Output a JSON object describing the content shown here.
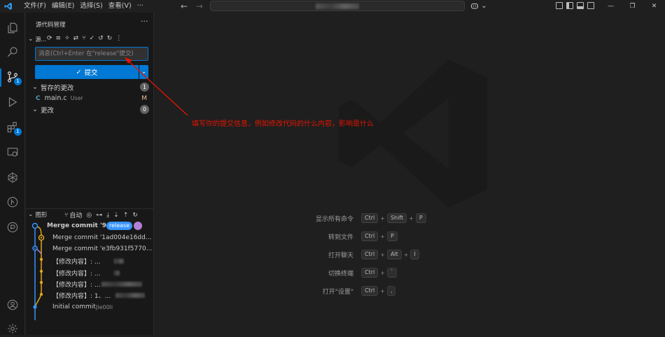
{
  "titlebar": {
    "menu": [
      "文件(F)",
      "编辑(E)",
      "选择(S)",
      "查看(V)",
      "···"
    ],
    "nav_back": "←",
    "nav_forward": "→",
    "copilot_label": "⌄"
  },
  "activity": {
    "scm_badge": "1",
    "extensions_badge": "1"
  },
  "sidebar": {
    "title": "源代码管理",
    "more": "···",
    "section_label": "源...",
    "message_placeholder": "消息(Ctrl+Enter 在\"release\"提交)",
    "commit_label": "提交",
    "staged_label": "暂存的更改",
    "staged_count": "1",
    "staged_file": {
      "name": "main.c",
      "dir": "User",
      "status": "M"
    },
    "changes_label": "更改",
    "changes_count": "0"
  },
  "graph": {
    "header": "图形",
    "auto_label": "自动",
    "commits": [
      {
        "text": "Merge commit '9...",
        "tag": "release"
      },
      {
        "text": "Merge commit '1ad004e16dd..."
      },
      {
        "text": "Merge commit 'e3fb931f5770..."
      },
      {
        "text": "【修改内容】: ..."
      },
      {
        "text": "【修改内容】: ..."
      },
      {
        "text": "【修改内容】: ..."
      },
      {
        "text": "【修改内容】: 1、..."
      },
      {
        "text": "Initial commit",
        "author": "Jie00li"
      }
    ]
  },
  "editor": {
    "shortcuts": [
      {
        "label": "显示所有命令",
        "keys": [
          "Ctrl",
          "Shift",
          "P"
        ]
      },
      {
        "label": "转到文件",
        "keys": [
          "Ctrl",
          "P"
        ]
      },
      {
        "label": "打开聊天",
        "keys": [
          "Ctrl",
          "Alt",
          "I"
        ]
      },
      {
        "label": "切换终端",
        "keys": [
          "Ctrl",
          "`"
        ]
      },
      {
        "label": "打开\"设置\"",
        "keys": [
          "Ctrl",
          ","
        ]
      }
    ]
  },
  "annotation": {
    "text": "填写你的提交信息，例如修改代码的什么内容，影响是什么",
    "color": "#e51400"
  },
  "colors": {
    "accent": "#0078d4",
    "background": "#1f1f1f",
    "sidebar": "#181818"
  }
}
